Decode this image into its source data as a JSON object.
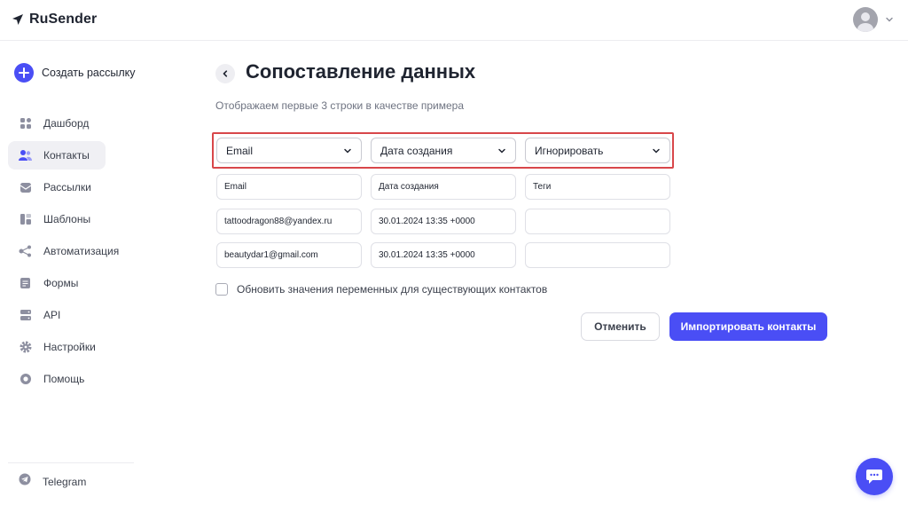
{
  "app": {
    "name": "RuSender"
  },
  "sidebar": {
    "create_label": "Создать рассылку",
    "items": [
      {
        "label": "Дашборд",
        "icon": "grid-icon"
      },
      {
        "label": "Контакты",
        "icon": "contacts-icon",
        "active": true
      },
      {
        "label": "Рассылки",
        "icon": "mail-icon"
      },
      {
        "label": "Шаблоны",
        "icon": "template-icon"
      },
      {
        "label": "Автоматизация",
        "icon": "automation-icon"
      },
      {
        "label": "Формы",
        "icon": "form-icon"
      },
      {
        "label": "API",
        "icon": "api-icon"
      },
      {
        "label": "Настройки",
        "icon": "gear-icon"
      },
      {
        "label": "Помощь",
        "icon": "help-icon"
      }
    ],
    "telegram_label": "Telegram"
  },
  "main": {
    "title": "Сопоставление данных",
    "subtitle": "Отображаем первые 3 строки в качестве примера",
    "mapping": [
      "Email",
      "Дата создания",
      "Игнорировать"
    ],
    "rows": [
      [
        "Email",
        "Дата создания",
        "Теги"
      ],
      [
        "tattoodragon88@yandex.ru",
        "30.01.2024 13:35 +0000",
        ""
      ],
      [
        "beautydar1@gmail.com",
        "30.01.2024 13:35 +0000",
        ""
      ]
    ],
    "checkbox_label": "Обновить значения переменных для существующих контактов",
    "cancel_label": "Отменить",
    "import_label": "Импортировать контакты"
  },
  "colors": {
    "accent": "#4a4ef5",
    "highlight": "#d8474a"
  }
}
